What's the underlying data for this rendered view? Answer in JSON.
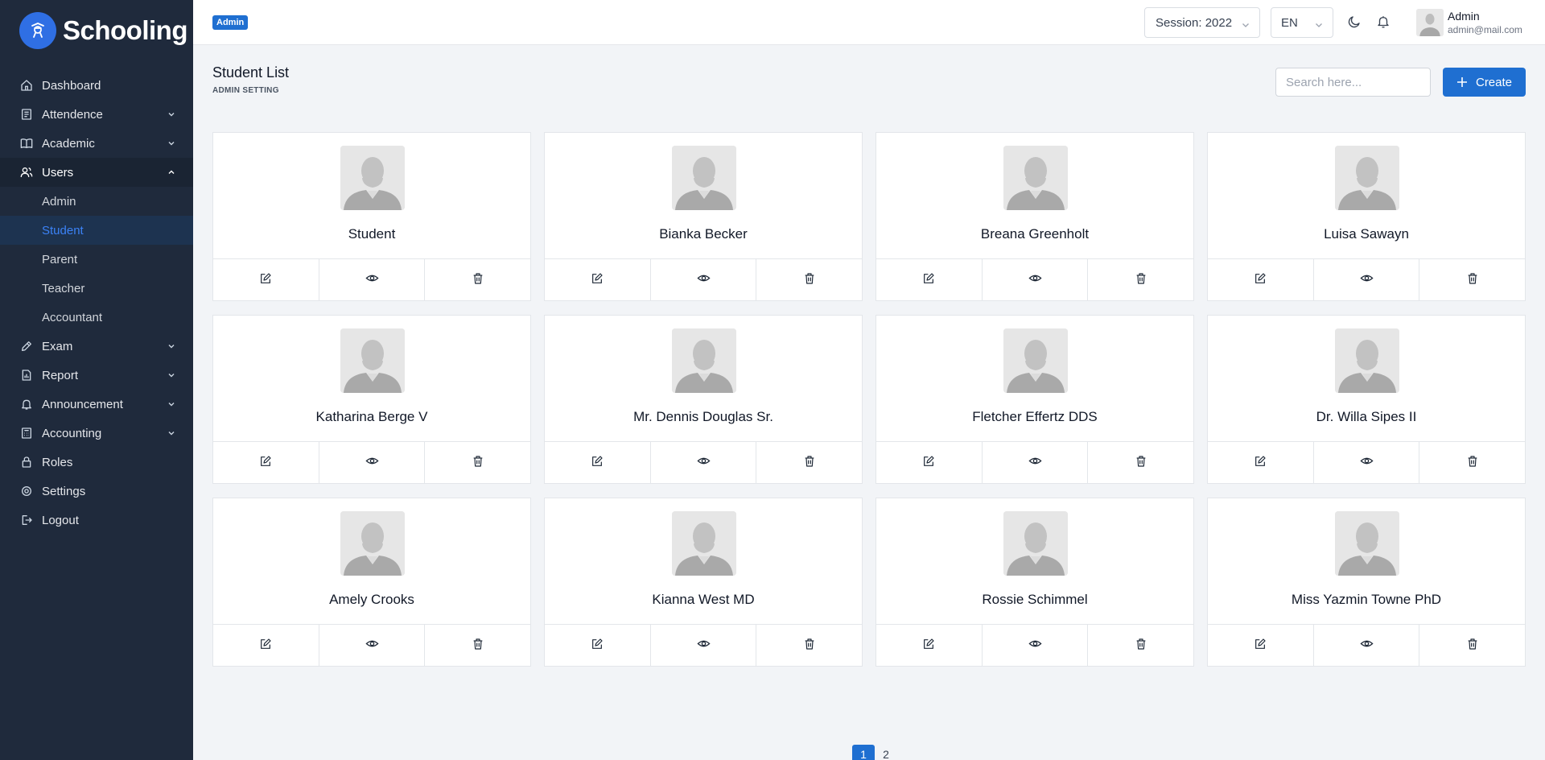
{
  "brand": {
    "name": "Schooling"
  },
  "sidebar": {
    "items": [
      {
        "label": "Dashboard",
        "icon": "home-icon",
        "chevron": false
      },
      {
        "label": "Attendence",
        "icon": "clipboard-icon",
        "chevron": true
      },
      {
        "label": "Academic",
        "icon": "book-icon",
        "chevron": true
      },
      {
        "label": "Users",
        "icon": "users-icon",
        "chevron": true,
        "open": true
      },
      {
        "label": "Exam",
        "icon": "pencil-icon",
        "chevron": true
      },
      {
        "label": "Report",
        "icon": "report-icon",
        "chevron": true
      },
      {
        "label": "Announcement",
        "icon": "bell-icon",
        "chevron": true
      },
      {
        "label": "Accounting",
        "icon": "calculator-icon",
        "chevron": true
      },
      {
        "label": "Roles",
        "icon": "lock-icon",
        "chevron": false
      },
      {
        "label": "Settings",
        "icon": "gear-icon",
        "chevron": false
      },
      {
        "label": "Logout",
        "icon": "logout-icon",
        "chevron": false
      }
    ],
    "users_sub": [
      "Admin",
      "Student",
      "Parent",
      "Teacher",
      "Accountant"
    ],
    "active_sub": "Student"
  },
  "header": {
    "role_badge": "Admin",
    "session": "Session: 2022",
    "language": "EN",
    "user_name": "Admin",
    "user_email": "admin@mail.com"
  },
  "page": {
    "title": "Student List",
    "subtitle": "ADMIN SETTING",
    "search_placeholder": "Search here...",
    "create_label": "Create"
  },
  "students": [
    "Student",
    "Bianka Becker",
    "Breana Greenholt",
    "Luisa Sawayn",
    "Katharina Berge V",
    "Mr. Dennis Douglas Sr.",
    "Fletcher Effertz DDS",
    "Dr. Willa Sipes II",
    "Amely Crooks",
    "Kianna West MD",
    "Rossie Schimmel",
    "Miss Yazmin Towne PhD"
  ],
  "pagination": {
    "pages": [
      "1",
      "2"
    ],
    "current": "1"
  },
  "colors": {
    "sidebar_bg": "#1f2a3c",
    "accent": "#1f6fd1",
    "page_bg": "#f2f4f7"
  }
}
